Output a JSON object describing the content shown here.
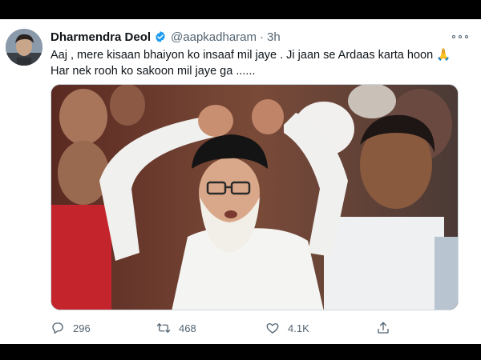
{
  "tweet": {
    "author": {
      "name": "Dharmendra Deol",
      "handle": "@aapkadharam",
      "verified": true
    },
    "timestamp": "3h",
    "text_lines": [
      "Aaj , mere kisaan bhaiyon ko insaaf mil jaye . Ji jaan se Ardaas karta hoon 🙏",
      "Har nek rooh ko sakoon mil jaye ga ......"
    ],
    "media": {
      "type": "photo"
    },
    "actions": {
      "reply_count": "296",
      "retweet_count": "468",
      "like_count": "4.1K"
    }
  },
  "icons": {
    "verified": "verified-badge-icon",
    "more": "more-options-icon",
    "reply": "reply-icon",
    "retweet": "retweet-icon",
    "like": "heart-icon",
    "share": "share-icon"
  },
  "colors": {
    "accent": "#1d9bf0",
    "secondary_text": "#536471",
    "primary_text": "#0f1419",
    "background": "#ffffff"
  }
}
